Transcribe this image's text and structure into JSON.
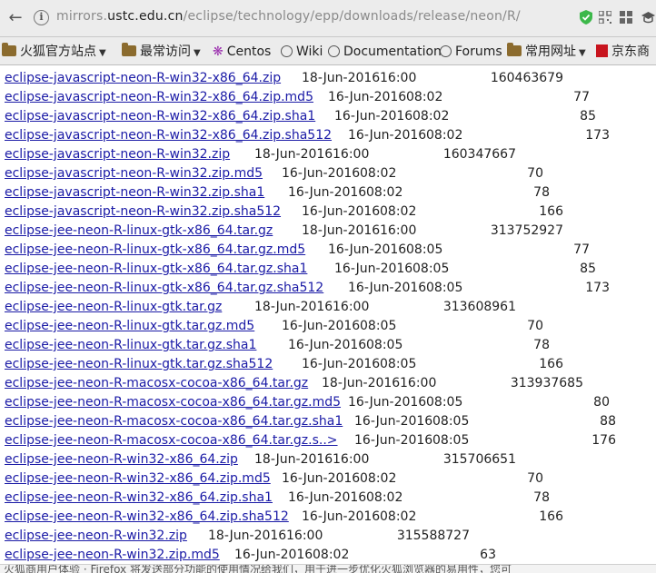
{
  "urlbar": {
    "url_prefix": "mirrors.",
    "url_host": "ustc.edu.cn",
    "url_path": "/eclipse/technology/epp/downloads/release/neon/R/",
    "icons": [
      "back-icon",
      "forward-icon",
      "info-icon",
      "shield-icon",
      "qr-icon",
      "grid-icon",
      "cap-icon"
    ]
  },
  "bookmarks": [
    {
      "label": "火狐官方站点",
      "icon": "folder-icon",
      "menu": true
    },
    {
      "label": "最常访问",
      "icon": "folder-icon",
      "menu": true
    },
    {
      "label": "Centos",
      "icon": "centos-icon",
      "menu": false
    },
    {
      "label": "Wiki",
      "icon": "globe-icon",
      "menu": false
    },
    {
      "label": "Documentation",
      "icon": "globe-icon",
      "menu": false
    },
    {
      "label": "Forums",
      "icon": "globe-icon",
      "menu": false
    },
    {
      "label": "常用网址",
      "icon": "folder-icon",
      "menu": true
    },
    {
      "label": "京东商",
      "icon": "jd-icon",
      "menu": false
    }
  ],
  "files": [
    {
      "name": "eclipse-javascript-neon-R-win32-x86_64.zip",
      "date": "18-Jun-2016",
      "time": "16:00",
      "size": "160463679"
    },
    {
      "name": "eclipse-javascript-neon-R-win32-x86_64.zip.md5",
      "date": "16-Jun-2016",
      "time": "08:02",
      "size": "77"
    },
    {
      "name": "eclipse-javascript-neon-R-win32-x86_64.zip.sha1",
      "date": "16-Jun-2016",
      "time": "08:02",
      "size": "85"
    },
    {
      "name": "eclipse-javascript-neon-R-win32-x86_64.zip.sha512",
      "date": "16-Jun-2016",
      "time": "08:02",
      "size": "173"
    },
    {
      "name": "eclipse-javascript-neon-R-win32.zip",
      "date": "18-Jun-2016",
      "time": "16:00",
      "size": "160347667"
    },
    {
      "name": "eclipse-javascript-neon-R-win32.zip.md5",
      "date": "16-Jun-2016",
      "time": "08:02",
      "size": "70"
    },
    {
      "name": "eclipse-javascript-neon-R-win32.zip.sha1",
      "date": "16-Jun-2016",
      "time": "08:02",
      "size": "78"
    },
    {
      "name": "eclipse-javascript-neon-R-win32.zip.sha512",
      "date": "16-Jun-2016",
      "time": "08:02",
      "size": "166"
    },
    {
      "name": "eclipse-jee-neon-R-linux-gtk-x86_64.tar.gz",
      "date": "18-Jun-2016",
      "time": "16:00",
      "size": "313752927"
    },
    {
      "name": "eclipse-jee-neon-R-linux-gtk-x86_64.tar.gz.md5",
      "date": "16-Jun-2016",
      "time": "08:05",
      "size": "77"
    },
    {
      "name": "eclipse-jee-neon-R-linux-gtk-x86_64.tar.gz.sha1",
      "date": "16-Jun-2016",
      "time": "08:05",
      "size": "85"
    },
    {
      "name": "eclipse-jee-neon-R-linux-gtk-x86_64.tar.gz.sha512",
      "date": "16-Jun-2016",
      "time": "08:05",
      "size": "173"
    },
    {
      "name": "eclipse-jee-neon-R-linux-gtk.tar.gz",
      "date": "18-Jun-2016",
      "time": "16:00",
      "size": "313608961"
    },
    {
      "name": "eclipse-jee-neon-R-linux-gtk.tar.gz.md5",
      "date": "16-Jun-2016",
      "time": "08:05",
      "size": "70"
    },
    {
      "name": "eclipse-jee-neon-R-linux-gtk.tar.gz.sha1",
      "date": "16-Jun-2016",
      "time": "08:05",
      "size": "78"
    },
    {
      "name": "eclipse-jee-neon-R-linux-gtk.tar.gz.sha512",
      "date": "16-Jun-2016",
      "time": "08:05",
      "size": "166"
    },
    {
      "name": "eclipse-jee-neon-R-macosx-cocoa-x86_64.tar.gz",
      "date": "18-Jun-2016",
      "time": "16:00",
      "size": "313937685"
    },
    {
      "name": "eclipse-jee-neon-R-macosx-cocoa-x86_64.tar.gz.md5",
      "date": "16-Jun-2016",
      "time": "08:05",
      "size": "80"
    },
    {
      "name": "eclipse-jee-neon-R-macosx-cocoa-x86_64.tar.gz.sha1",
      "date": "16-Jun-2016",
      "time": "08:05",
      "size": "88"
    },
    {
      "name": "eclipse-jee-neon-R-macosx-cocoa-x86_64.tar.gz.s..>",
      "date": "16-Jun-2016",
      "time": "08:05",
      "size": "176"
    },
    {
      "name": "eclipse-jee-neon-R-win32-x86_64.zip",
      "date": "18-Jun-2016",
      "time": "16:00",
      "size": "315706651"
    },
    {
      "name": "eclipse-jee-neon-R-win32-x86_64.zip.md5",
      "date": "16-Jun-2016",
      "time": "08:02",
      "size": "70"
    },
    {
      "name": "eclipse-jee-neon-R-win32-x86_64.zip.sha1",
      "date": "16-Jun-2016",
      "time": "08:02",
      "size": "78"
    },
    {
      "name": "eclipse-jee-neon-R-win32-x86_64.zip.sha512",
      "date": "16-Jun-2016",
      "time": "08:02",
      "size": "166"
    },
    {
      "name": "eclipse-jee-neon-R-win32.zip",
      "date": "18-Jun-2016",
      "time": "16:00",
      "size": "315588727"
    },
    {
      "name": "eclipse-jee-neon-R-win32.zip.md5",
      "date": "16-Jun-2016",
      "time": "08:02",
      "size": "63"
    }
  ],
  "statusbar": {
    "text": "火狐商用户体验 · Firefox 将发送部分功能的使用情况给我们，用于进一步优化火狐浏览器的易用性，您可"
  },
  "colors": {
    "link": "#1a1aa6",
    "chrome": "#ececec",
    "text": "#222222"
  }
}
